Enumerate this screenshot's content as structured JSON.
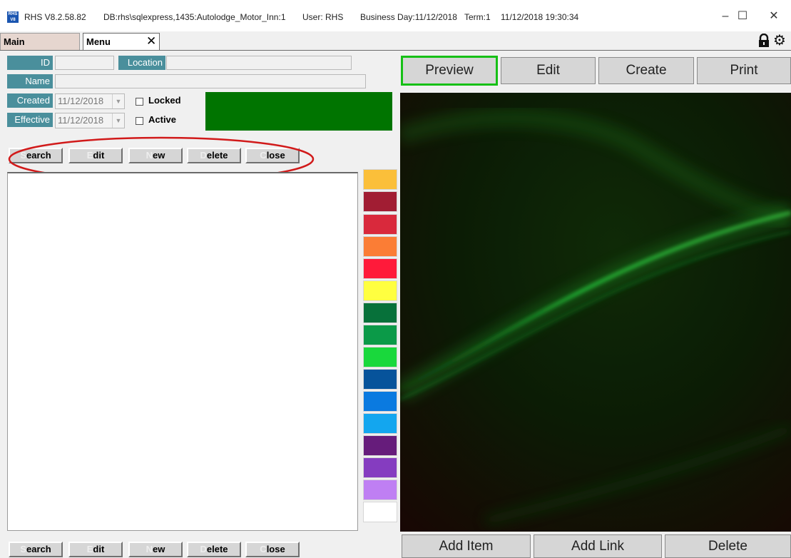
{
  "titlebar": {
    "app_icon_text": "RHS V8",
    "version": "RHS V8.2.58.82",
    "db": "DB:rhs\\sqlexpress,1435:Autolodge_Motor_Inn:1",
    "user": "User: RHS",
    "business_day": "Business Day:11/12/2018",
    "term": "Term:1",
    "datetime": "11/12/2018 19:30:34",
    "minimize": "–",
    "maximize": "☐",
    "close": "✕"
  },
  "tabs": {
    "main": "Main",
    "menu": "Menu",
    "close": "✕"
  },
  "toolbar_icons": {
    "lock": "lock-icon",
    "settings": "gear-icon",
    "settings_glyph": "⚙"
  },
  "form": {
    "id_label": "ID",
    "id_value": "",
    "location_label": "Location",
    "location_value": "",
    "name_label": "Name",
    "name_value": "",
    "created_label": "Created",
    "created_value": "11/12/2018",
    "effective_label": "Effective",
    "effective_value": "11/12/2018",
    "locked_label": "Locked",
    "active_label": "Active",
    "dropdown_glyph": "▼",
    "color_preview": "#007400"
  },
  "actions_top": [
    {
      "hot": "S",
      "rest": "earch"
    },
    {
      "hot": "E",
      "rest": "dit"
    },
    {
      "hot": "N",
      "rest": "ew"
    },
    {
      "hot": "D",
      "rest": "elete"
    },
    {
      "hot": "C",
      "rest": "lose"
    }
  ],
  "actions_bottom": [
    {
      "hot": "S",
      "rest": "earch"
    },
    {
      "hot": "E",
      "rest": "dit"
    },
    {
      "hot": "N",
      "rest": "ew"
    },
    {
      "hot": "D",
      "rest": "elete"
    },
    {
      "hot": "C",
      "rest": "lose"
    }
  ],
  "swatches": [
    "#fbbf3a",
    "#a11d33",
    "#d9293c",
    "#fb7d35",
    "#ff1a3a",
    "#ffff40",
    "#07713a",
    "#0b9a48",
    "#19d83c",
    "#06539b",
    "#0a7ae0",
    "#13a6ef",
    "#661c7b",
    "#853cc0",
    "#bf7ff3",
    "#ffffff"
  ],
  "right_toolbar": {
    "preview": "Preview",
    "edit": "Edit",
    "create": "Create",
    "print": "Print"
  },
  "right_bottom": {
    "add_item": "Add Item",
    "add_link": "Add Link",
    "delete": "Delete"
  },
  "colors": {
    "label_bg": "#4a8f9c",
    "preview_border": "#16c016",
    "annotation": "#d11a1a"
  }
}
